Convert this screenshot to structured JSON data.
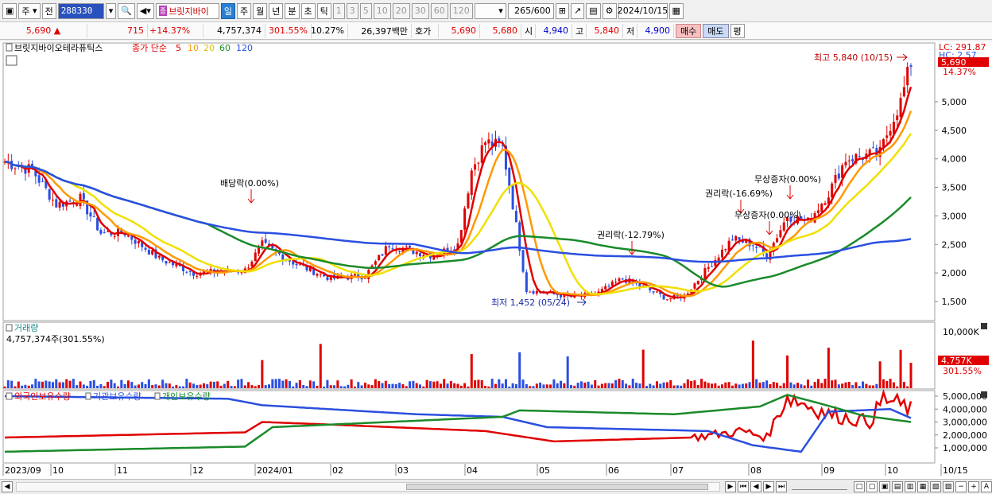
{
  "toolbar": {
    "view_mode": "주",
    "prev_label": "전",
    "stock_code": "288330",
    "stock_name": "브릿지바이",
    "stock_badge": "종",
    "periods": [
      "일",
      "주",
      "월",
      "년",
      "분",
      "초",
      "틱"
    ],
    "selected_period": "일",
    "intervals": [
      "1",
      "3",
      "5",
      "10",
      "20",
      "30",
      "60",
      "120"
    ],
    "count": "265",
    "count_total": "/600",
    "date": "2024/10/15"
  },
  "quote": {
    "price": "5,690",
    "change": "715",
    "change_pct": "+14.37%",
    "volume": "4,757,374",
    "volume_ratio": "301.55%",
    "turnover": "10.27%",
    "amount": "26,397백만",
    "bid_label": "호가",
    "ask": "5,690",
    "bid": "5,680",
    "open_label": "시",
    "open": "4,940",
    "high_label": "고",
    "high": "5,840",
    "low_label": "저",
    "low": "4,900",
    "buy_btn": "매수",
    "sell_btn": "매도",
    "avg_btn": "평"
  },
  "price_panel": {
    "stock_tag": "브릿지바이오테라퓨틱스",
    "ma_label": "종가 단순",
    "ma_periods": [
      "5",
      "10",
      "20",
      "60",
      "120"
    ],
    "ma_colors": [
      "#e00000",
      "#ff9900",
      "#f0e000",
      "#1a8a2a",
      "#2a4fe0"
    ],
    "lc": "LC: 291.87",
    "hc": "HC: 2.57",
    "current_price_tag": "5,690",
    "current_pct_tag": "14.37%",
    "y_ticks": [
      "5,000",
      "4,500",
      "4,000",
      "3,500",
      "3,000",
      "2,500",
      "2,000",
      "1,500"
    ],
    "annotations": {
      "high": "최고 5,840 (10/15)",
      "low": "최저 1,452 (05/24)",
      "div": "배당락(0.00%)",
      "rights1": "권리락(-12.79%)",
      "rights2": "권리락(-16.69%)",
      "bonus1": "무상증자(0.00%)",
      "bonus2": "무상증자(0.00%)"
    }
  },
  "volume_panel": {
    "title": "거래량",
    "value": "4,757,374주(301.55%)",
    "y_top": "10,000K",
    "tag": "4,757K",
    "tag_pct": "301.55%"
  },
  "holders_panel": {
    "series": [
      "외국인보유수량",
      "기관보유수량",
      "개인보유수량"
    ],
    "series_colors": [
      "#e00000",
      "#2a4fe0",
      "#1a8a2a"
    ],
    "y_ticks": [
      "5,000,000",
      "4,000,000",
      "3,000,000",
      "2,000,000",
      "1,000,000"
    ]
  },
  "x_axis": [
    "2023/09",
    "10",
    "11",
    "12",
    "2024/01",
    "02",
    "03",
    "04",
    "05",
    "06",
    "07",
    "08",
    "09",
    "10",
    "10/15"
  ]
}
